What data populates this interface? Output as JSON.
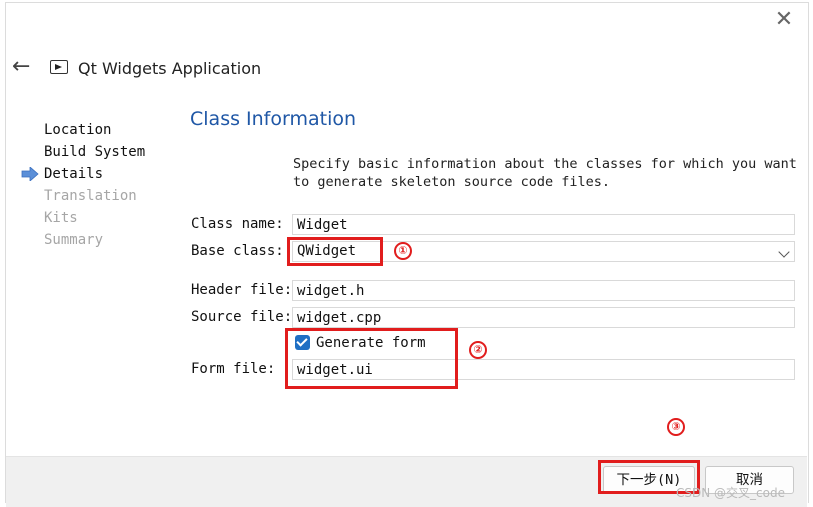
{
  "wizard": {
    "title": "Qt Widgets Application",
    "close_icon": "close-icon",
    "back_icon": "arrow-left-icon"
  },
  "sidebar": {
    "steps": [
      {
        "label": "Location",
        "state": "done"
      },
      {
        "label": "Build System",
        "state": "done"
      },
      {
        "label": "Details",
        "state": "current"
      },
      {
        "label": "Translation",
        "state": "pending"
      },
      {
        "label": "Kits",
        "state": "pending"
      },
      {
        "label": "Summary",
        "state": "pending"
      }
    ]
  },
  "page": {
    "title": "Class Information",
    "description": "Specify basic information about the classes for which you want to generate skeleton source code files."
  },
  "form": {
    "class_name": {
      "label": "Class name:",
      "value": "Widget"
    },
    "base_class": {
      "label": "Base class:",
      "value": "QWidget"
    },
    "header_file": {
      "label": "Header file:",
      "value": "widget.h"
    },
    "source_file": {
      "label": "Source file:",
      "value": "widget.cpp"
    },
    "generate_form": {
      "label": "Generate form",
      "checked": true
    },
    "form_file": {
      "label": "Form file:",
      "value": "widget.ui"
    }
  },
  "buttons": {
    "next": "下一步(N)",
    "cancel": "取消"
  },
  "annotations": {
    "markers": [
      "①",
      "②",
      "③"
    ],
    "color": "#e11d1d"
  },
  "watermark": "CSDN @交叉_code",
  "colors": {
    "title_blue": "#1f57a6",
    "checkbox_blue": "#1f6fc4",
    "bottom_bar": "#f0f0f0"
  }
}
